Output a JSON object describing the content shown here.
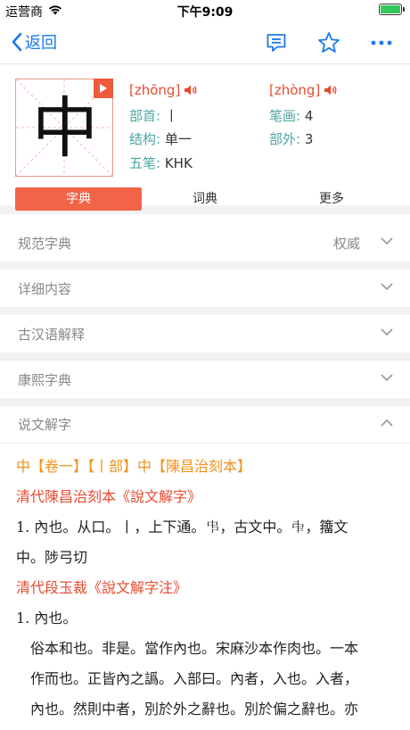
{
  "status": {
    "carrier": "运营商",
    "time": "下午9:09"
  },
  "nav": {
    "back_label": "返回"
  },
  "character": {
    "glyph": "中",
    "pinyin1": "[zhōng]",
    "pinyin2": "[zhòng]",
    "radical_label": "部首:",
    "radical_value": "丨",
    "strokes_label": "笔画:",
    "strokes_value": "4",
    "structure_label": "结构:",
    "structure_value": "单一",
    "outside_label": "部外:",
    "outside_value": "3",
    "wubi_label": "五笔:",
    "wubi_value": "KHK"
  },
  "tabs": [
    {
      "label": "字典",
      "active": true
    },
    {
      "label": "词典",
      "active": false
    },
    {
      "label": "更多",
      "active": false
    }
  ],
  "sections": [
    {
      "title": "规范字典",
      "extra": "权威"
    },
    {
      "title": "详细内容",
      "extra": ""
    },
    {
      "title": "古汉语解释",
      "extra": ""
    },
    {
      "title": "康熙字典",
      "extra": ""
    },
    {
      "title": "说文解字",
      "extra": ""
    }
  ],
  "shuowen": {
    "header": "中【卷一】【丨部】中【陳昌治刻本】",
    "source1": "清代陳昌治刻本《說文解字》",
    "entry1_line1": "1. 內也。从口。丨，上下通。𠁧，古文中。𠁩，籒文",
    "entry1_line2": "中。陟弓切",
    "source2": "清代段玉裁《說文解字注》",
    "entry2_head": "1. 內也。",
    "entry2_line1": "俗本和也。非是。當作內也。宋麻沙本作肉也。一本",
    "entry2_line2": "作而也。正皆內之譌。入部曰。內者，入也。入者，",
    "entry2_line3": "內也。然則中者，別於外之辭也。別於偏之辭也。亦"
  },
  "colors": {
    "accent": "#1a7ae8",
    "tab_active": "#f26448",
    "label_teal": "#4aa6a0",
    "pinyin_red": "#e64a2e",
    "header_orange": "#f0921a"
  }
}
